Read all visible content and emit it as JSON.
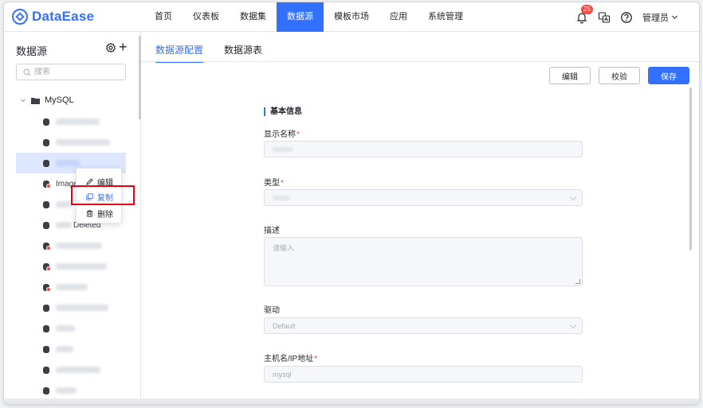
{
  "app": {
    "logo_text": "DataEase"
  },
  "nav": {
    "items": [
      "首页",
      "仪表板",
      "数据集",
      "数据源",
      "模板市场",
      "应用",
      "系统管理"
    ],
    "active_index": 3
  },
  "header": {
    "notification_count": "25",
    "user_label": "管理员"
  },
  "sidebar": {
    "title": "数据源",
    "search_placeholder": "搜索",
    "root_label": "MySQL",
    "visible_labels": {
      "item4": "Image",
      "item6": "Deleted"
    }
  },
  "context_menu": {
    "edit": "编辑",
    "copy": "复制",
    "delete": "删除"
  },
  "main": {
    "tabs": [
      "数据源配置",
      "数据源表"
    ],
    "buttons": {
      "edit": "编辑",
      "validate": "校验",
      "save": "保存"
    },
    "section_title": "基本信息",
    "fields": {
      "display_name": "显示名称",
      "type": "类型",
      "description": "描述",
      "description_placeholder": "请输入",
      "driver": "驱动",
      "driver_value": "Default",
      "host": "主机名/IP地址",
      "host_value": "mysql"
    }
  },
  "colors": {
    "accent": "#3370ff",
    "error": "#f54a45",
    "highlight_box": "#e60012"
  }
}
